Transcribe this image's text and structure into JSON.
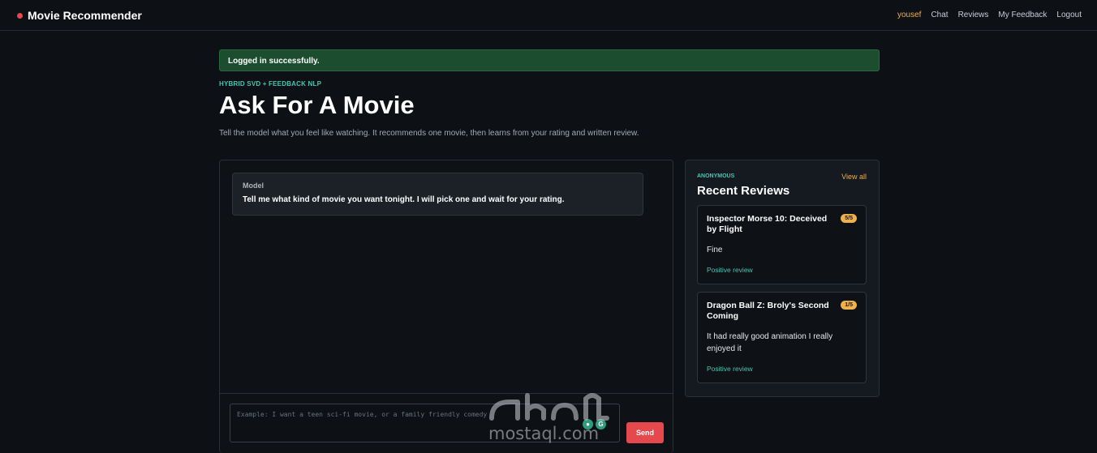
{
  "nav": {
    "brand": "Movie Recommender",
    "user": "yousef",
    "links": [
      "Chat",
      "Reviews",
      "My Feedback",
      "Logout"
    ]
  },
  "flash": "Logged in successfully.",
  "hero": {
    "eyebrow": "HYBRID SVD + FEEDBACK NLP",
    "title": "Ask For A Movie",
    "subtitle": "Tell the model what you feel like watching. It recommends one movie, then learns from your rating and written review."
  },
  "chat": {
    "message": {
      "role": "Model",
      "text": "Tell me what kind of movie you want tonight. I will pick one and wait for your rating."
    },
    "input_placeholder": "Example: I want a teen sci-fi movie, or a family friendly comedy",
    "send_label": "Send"
  },
  "sidebar": {
    "eyebrow": "ANONYMOUS",
    "view_all": "View all",
    "title": "Recent Reviews",
    "reviews": [
      {
        "title": "Inspector Morse 10: Deceived by Flight",
        "rating": "5/5",
        "text": "Fine",
        "sentiment": "Positive review"
      },
      {
        "title": "Dragon Ball Z: Broly's Second Coming",
        "rating": "1/5",
        "text": "It had really good animation I really enjoyed it",
        "sentiment": "Positive review"
      }
    ]
  },
  "watermark": {
    "latin": "mostaql.com"
  },
  "colors": {
    "accent_red": "#e5484d",
    "accent_teal": "#4fc3b1",
    "accent_amber": "#f0b04a",
    "flash_green": "#1b4d2e"
  }
}
